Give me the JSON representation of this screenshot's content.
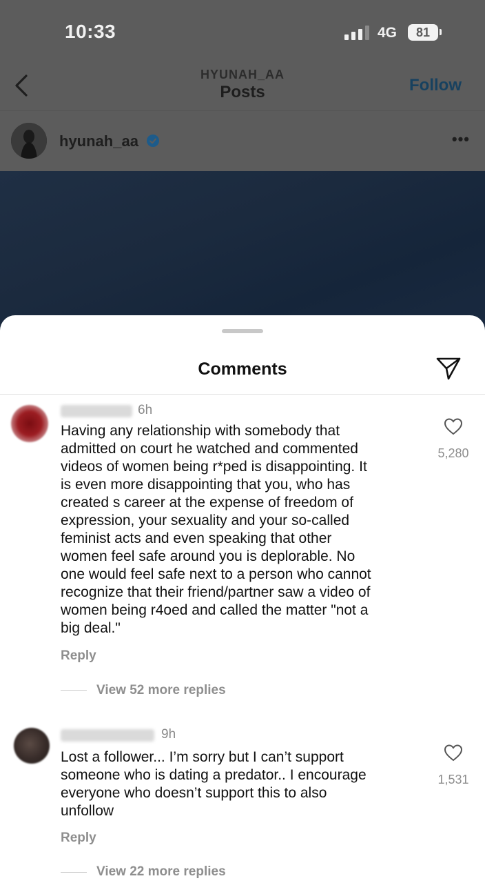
{
  "status_bar": {
    "time": "10:33",
    "network": "4G",
    "battery": "81"
  },
  "nav": {
    "subtitle": "HYUNAH_AA",
    "title": "Posts",
    "follow_label": "Follow"
  },
  "post": {
    "username": "hyunah_aa"
  },
  "sheet": {
    "title": "Comments"
  },
  "comments": [
    {
      "time": "6h",
      "text": "Having any relationship with somebody that\nadmitted on court he watched and commented\nvideos of women being r*ped is disappointing. It\nis even more disappointing that you, who has\ncreated s career at the expense of freedom of\nexpression, your sexuality and your so-called\nfeminist acts and even speaking that other\nwomen feel safe around you is deplorable. No\none would feel safe next to a person who cannot\nrecognize that their friend/partner saw a video of\nwomen being r4oed and called the matter \"not a\nbig deal.\"",
      "likes": "5,280",
      "reply_label": "Reply",
      "view_replies": "View 52 more replies"
    },
    {
      "time": "9h",
      "text": "Lost a follower... I’m sorry but I can’t support\nsomeone who is dating a predator.. I encourage\neveryone who doesn’t support this to also\nunfollow",
      "likes": "1,531",
      "reply_label": "Reply",
      "view_replies": "View 22 more replies"
    }
  ],
  "colors": {
    "follow": "#17415f",
    "sheet_background": "#ffffff",
    "verified_badge": "#1d5b8a",
    "overlay": "#5c5c5c"
  }
}
